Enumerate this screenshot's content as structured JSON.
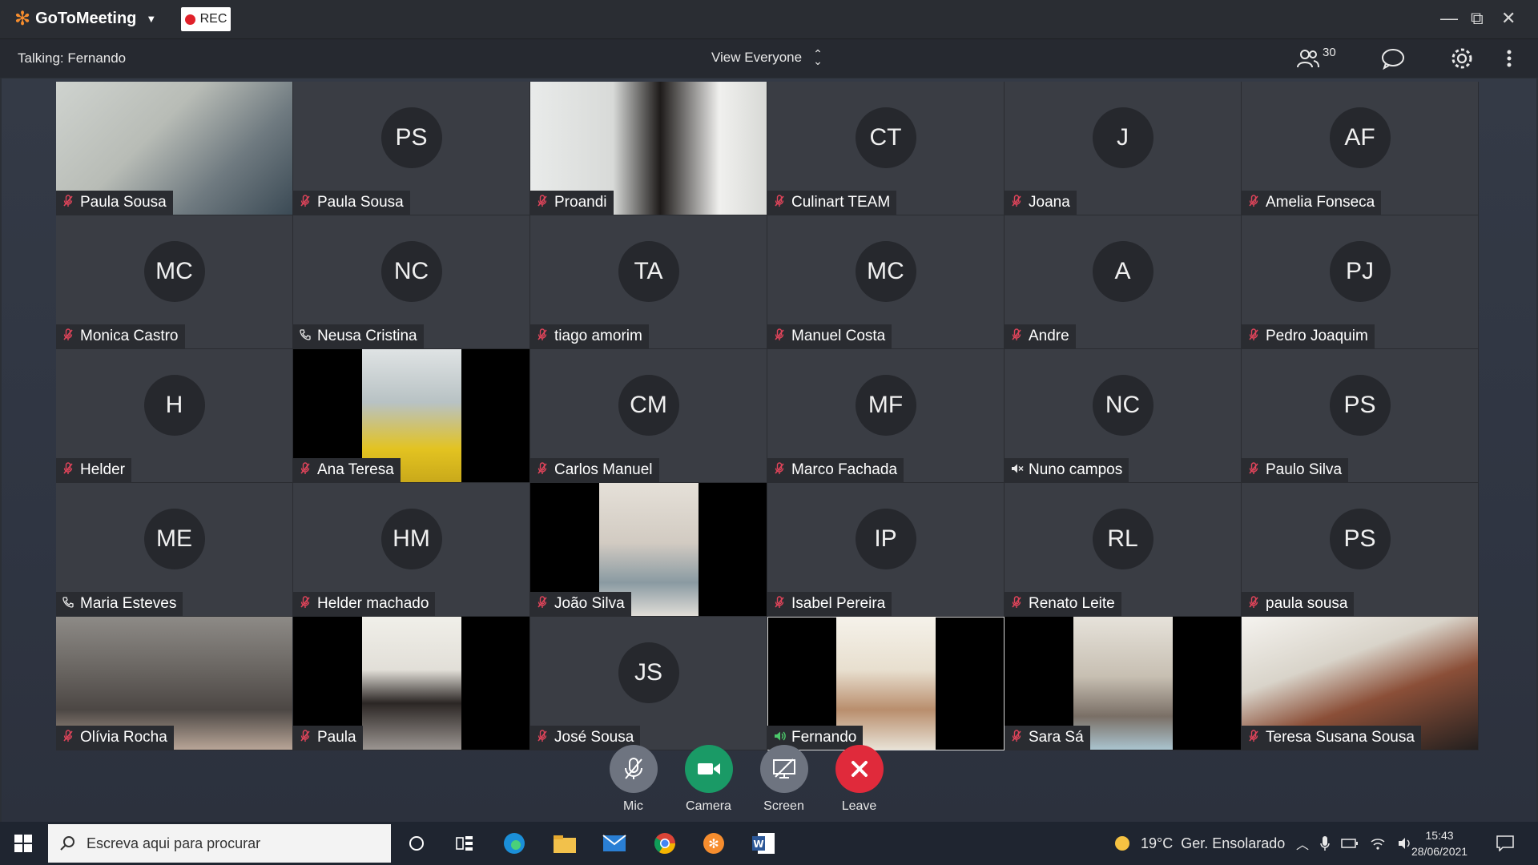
{
  "app": {
    "name": "GoToMeeting",
    "rec_label": "REC"
  },
  "window_controls": {
    "minimize": "—",
    "restore": "⧉",
    "close": "✕"
  },
  "toolbar": {
    "talking_label": "Talking: Fernando",
    "view_label": "View Everyone",
    "participants_count": "30"
  },
  "tiles": [
    {
      "name": "Paula Sousa",
      "status": "muted",
      "video": "bg-room1",
      "layout": "full"
    },
    {
      "name": "Paula Sousa",
      "status": "muted",
      "initials": "PS"
    },
    {
      "name": "Proandi",
      "status": "muted",
      "video": "bg-room2",
      "layout": "full"
    },
    {
      "name": "Culinart TEAM",
      "status": "muted",
      "initials": "CT"
    },
    {
      "name": "Joana",
      "status": "muted",
      "initials": "J"
    },
    {
      "name": "Amelia Fonseca",
      "status": "muted",
      "initials": "AF"
    },
    {
      "name": "Monica Castro",
      "status": "muted",
      "initials": "MC"
    },
    {
      "name": "Neusa Cristina",
      "status": "phone",
      "initials": "NC"
    },
    {
      "name": "tiago amorim",
      "status": "muted",
      "initials": "TA"
    },
    {
      "name": "Manuel Costa",
      "status": "muted",
      "initials": "MC"
    },
    {
      "name": "Andre",
      "status": "muted",
      "initials": "A"
    },
    {
      "name": "Pedro Joaquim",
      "status": "muted",
      "initials": "PJ"
    },
    {
      "name": "Helder",
      "status": "muted",
      "initials": "H"
    },
    {
      "name": "Ana Teresa",
      "status": "muted",
      "video": "bg-room3",
      "layout": "narrow"
    },
    {
      "name": "Carlos Manuel",
      "status": "muted",
      "initials": "CM"
    },
    {
      "name": "Marco Fachada",
      "status": "muted",
      "initials": "MF"
    },
    {
      "name": "Nuno campos",
      "status": "speaker-off",
      "initials": "NC"
    },
    {
      "name": "Paulo Silva",
      "status": "muted",
      "initials": "PS"
    },
    {
      "name": "Maria Esteves",
      "status": "phone",
      "initials": "ME"
    },
    {
      "name": "Helder machado",
      "status": "muted",
      "initials": "HM"
    },
    {
      "name": "João Silva",
      "status": "muted",
      "video": "bg-room4",
      "layout": "narrow"
    },
    {
      "name": "Isabel Pereira",
      "status": "muted",
      "initials": "IP"
    },
    {
      "name": "Renato Leite",
      "status": "muted",
      "initials": "RL"
    },
    {
      "name": "paula sousa",
      "status": "muted",
      "initials": "PS"
    },
    {
      "name": "Olívia Rocha",
      "status": "muted",
      "video": "bg-room5",
      "layout": "full"
    },
    {
      "name": "Paula",
      "status": "muted",
      "video": "bg-room6",
      "layout": "narrow"
    },
    {
      "name": "José Sousa",
      "status": "muted",
      "initials": "JS"
    },
    {
      "name": "Fernando",
      "status": "talking",
      "video": "bg-room7",
      "layout": "narrow",
      "active": true
    },
    {
      "name": "Sara Sá",
      "status": "muted",
      "video": "bg-room8",
      "layout": "narrow"
    },
    {
      "name": "Teresa Susana Sousa",
      "status": "muted",
      "video": "bg-room9",
      "layout": "full"
    }
  ],
  "controls": [
    {
      "label": "Mic",
      "icon": "mic-off-icon",
      "style": "btn-grey"
    },
    {
      "label": "Camera",
      "icon": "camera-icon",
      "style": "btn-green"
    },
    {
      "label": "Screen",
      "icon": "screen-share-icon",
      "style": "btn-grey"
    },
    {
      "label": "Leave",
      "icon": "leave-icon",
      "style": "btn-red"
    }
  ],
  "taskbar": {
    "search_placeholder": "Escreva aqui para procurar",
    "weather": "19°C  Ger. Ensolarado",
    "time": "15:43",
    "date": "28/06/2021"
  },
  "colors": {
    "accent_orange": "#f68d2e",
    "muted_red": "#e0445a",
    "talking_green": "#4cc96b",
    "leave_red": "#e02a3b",
    "camera_green": "#1a9a66"
  }
}
